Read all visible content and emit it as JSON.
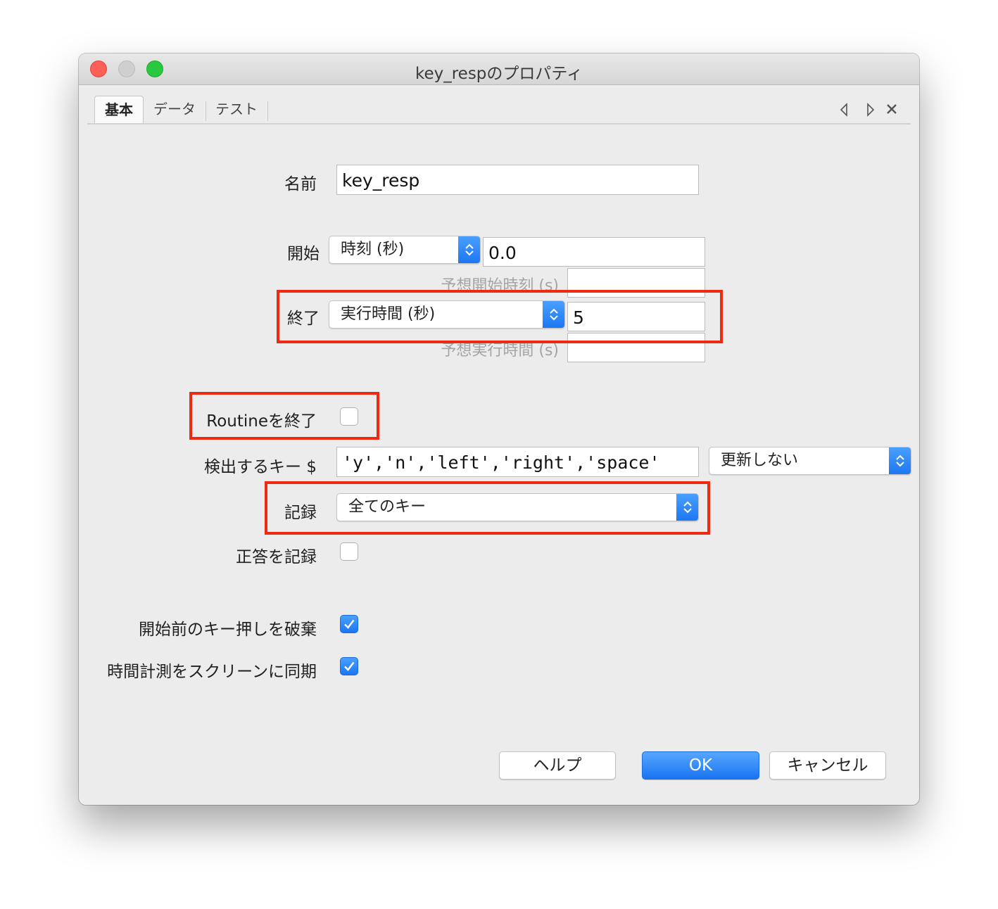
{
  "window": {
    "title": "key_respのプロパティ"
  },
  "tabs": [
    {
      "label": "基本",
      "active": true
    },
    {
      "label": "データ",
      "active": false
    },
    {
      "label": "テスト",
      "active": false
    }
  ],
  "form": {
    "name": {
      "label": "名前",
      "value": "key_resp"
    },
    "start": {
      "label": "開始",
      "type_value": "時刻 (秒)",
      "value": "0.0",
      "expected_label": "予想開始時刻 (s)",
      "expected_value": ""
    },
    "stop": {
      "label": "終了",
      "type_value": "実行時間 (秒)",
      "value": "5",
      "expected_label": "予想実行時間 (s)",
      "expected_value": ""
    },
    "force_end_routine": {
      "label": "Routineを終了",
      "checked": false
    },
    "allowed_keys": {
      "label": "検出するキー $",
      "value": "'y','n','left','right','space'",
      "update_value": "更新しない"
    },
    "store": {
      "label": "記録",
      "value": "全てのキー"
    },
    "store_correct": {
      "label": "正答を記録",
      "checked": false
    },
    "discard_previous": {
      "label": "開始前のキー押しを破棄",
      "checked": true
    },
    "sync_screen": {
      "label": "時間計測をスクリーンに同期",
      "checked": true
    }
  },
  "buttons": {
    "help": "ヘルプ",
    "ok": "OK",
    "cancel": "キャンセル"
  },
  "colors": {
    "accent": "#1a74f0",
    "highlight": "#ef2a14",
    "background": "#ececec"
  },
  "icons": [
    "prev-tab-icon",
    "next-tab-icon",
    "close-tab-icon",
    "checkmark-icon",
    "updown-arrows-icon"
  ]
}
